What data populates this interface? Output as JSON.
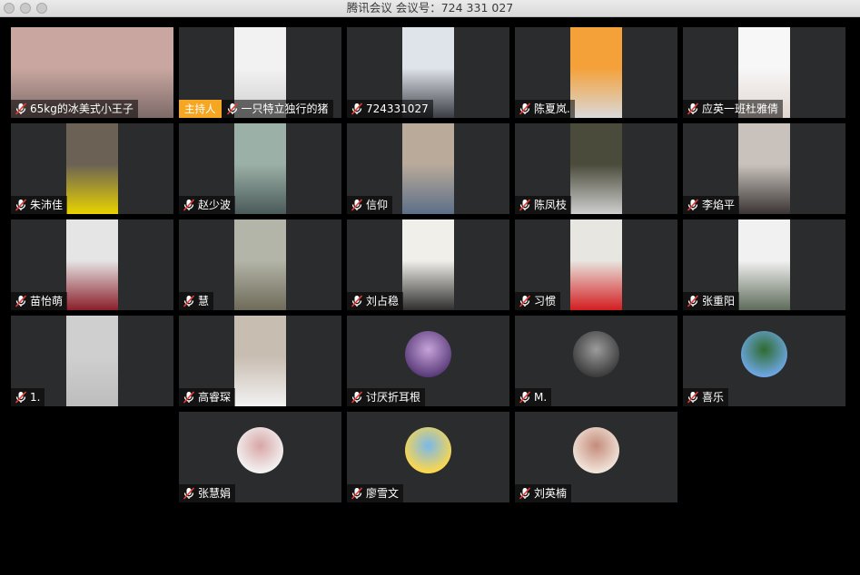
{
  "window": {
    "title": "腾讯会议 会议号：724 331 027"
  },
  "colors": {
    "background": "#000000",
    "tile": "#2b2c2e",
    "host_badge": "#f5a623",
    "mic_muted": "#ffffff"
  },
  "participants": [
    {
      "name": "65kg的冰美式小王子",
      "mic": "muted",
      "host": false,
      "media": "video"
    },
    {
      "name": "一只特立独行的猪",
      "mic": "muted",
      "host": true,
      "host_label": "主持人",
      "media": "video"
    },
    {
      "name": "724331027",
      "mic": "muted",
      "host": false,
      "media": "video"
    },
    {
      "name": "陈夏岚.",
      "mic": "muted",
      "host": false,
      "media": "video"
    },
    {
      "name": "应英一班杜雅倩",
      "mic": "muted",
      "host": false,
      "media": "video"
    },
    {
      "name": "朱沛佳",
      "mic": "muted",
      "host": false,
      "media": "video"
    },
    {
      "name": "赵少波",
      "mic": "muted",
      "host": false,
      "media": "video"
    },
    {
      "name": "信仰",
      "mic": "muted",
      "host": false,
      "media": "video"
    },
    {
      "name": "陈凤枝",
      "mic": "muted",
      "host": false,
      "media": "video"
    },
    {
      "name": "李焰平",
      "mic": "muted",
      "host": false,
      "media": "video"
    },
    {
      "name": "苗怡萌",
      "mic": "muted",
      "host": false,
      "media": "video"
    },
    {
      "name": "慧",
      "mic": "muted",
      "host": false,
      "media": "video"
    },
    {
      "name": "刘占稳",
      "mic": "muted",
      "host": false,
      "media": "video"
    },
    {
      "name": "习惯",
      "mic": "muted",
      "host": false,
      "media": "video"
    },
    {
      "name": "张重阳",
      "mic": "muted",
      "host": false,
      "media": "video"
    },
    {
      "name": "1.",
      "mic": "muted",
      "host": false,
      "media": "video"
    },
    {
      "name": "高睿琛",
      "mic": "muted",
      "host": false,
      "media": "video"
    },
    {
      "name": "讨厌折耳根",
      "mic": "muted",
      "host": false,
      "media": "avatar"
    },
    {
      "name": "M.",
      "mic": "muted",
      "host": false,
      "media": "avatar"
    },
    {
      "name": "喜乐",
      "mic": "muted",
      "host": false,
      "media": "avatar"
    },
    {
      "name": "张慧娟",
      "mic": "muted",
      "host": false,
      "media": "avatar"
    },
    {
      "name": "廖雪文",
      "mic": "muted",
      "host": false,
      "media": "avatar"
    },
    {
      "name": "刘英楠",
      "mic": "muted",
      "host": false,
      "media": "avatar"
    }
  ]
}
